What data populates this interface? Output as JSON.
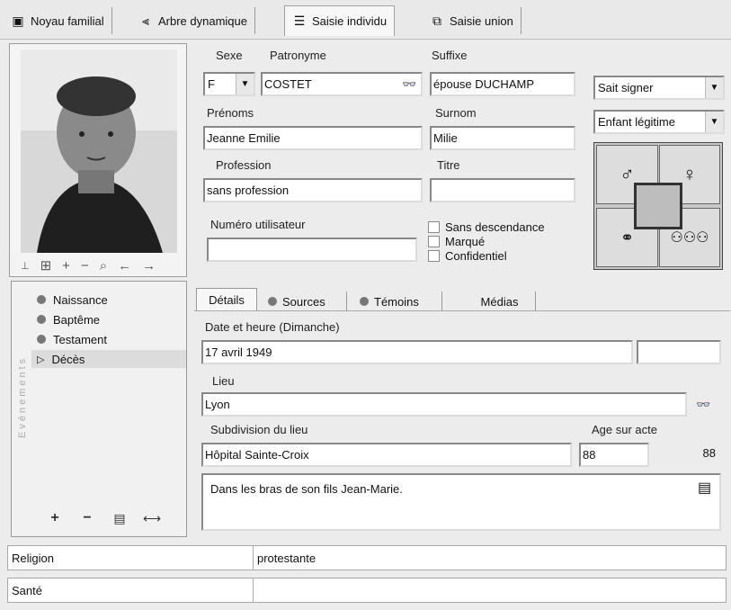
{
  "tabs": [
    {
      "label": "Noyau familial",
      "icon": "square-icon"
    },
    {
      "label": "Arbre dynamique",
      "icon": "tree-icon"
    },
    {
      "label": "Saisie individu",
      "icon": "list-icon"
    },
    {
      "label": "Saisie union",
      "icon": "union-icon"
    }
  ],
  "identity": {
    "sexe_label": "Sexe",
    "sexe_value": "F",
    "patronyme_label": "Patronyme",
    "patronyme_value": "COSTET",
    "suffixe_label": "Suffixe",
    "suffixe_value": "épouse DUCHAMP",
    "prenoms_label": "Prénoms",
    "prenoms_value": "Jeanne Emilie",
    "surnom_label": "Surnom",
    "surnom_value": "Milie",
    "profession_label": "Profession",
    "profession_value": "sans profession",
    "titre_label": "Titre",
    "titre_value": "",
    "numero_label": "Numéro utilisateur",
    "numero_value": "",
    "checks": [
      {
        "label": "Sans descendance",
        "checked": false
      },
      {
        "label": "Marqué",
        "checked": false
      },
      {
        "label": "Confidentiel",
        "checked": false
      }
    ]
  },
  "side": {
    "sait_signer": "Sait signer",
    "filiation": "Enfant légitime"
  },
  "photo_toolbar": {
    "page_icon": "page-icon",
    "grid_icon": "grid-icon",
    "plus": "+",
    "minus": "−",
    "search_icon": "search-icon",
    "left": "←",
    "right": "→"
  },
  "events": {
    "vertical_label": "Evénements",
    "items": [
      {
        "label": "Naissance",
        "type": "dot"
      },
      {
        "label": "Baptême",
        "type": "dot"
      },
      {
        "label": "Testament",
        "type": "dot"
      },
      {
        "label": "Décès",
        "type": "arrow"
      }
    ]
  },
  "details_tabs": [
    {
      "label": "Détails"
    },
    {
      "label": "Sources"
    },
    {
      "label": "Témoins"
    },
    {
      "label": "Médias"
    }
  ],
  "details": {
    "date_label": "Date et heure (Dimanche)",
    "date_value": "17 avril 1949",
    "heure_value": "",
    "lieu_label": "Lieu",
    "lieu_value": "Lyon",
    "subdivision_label": "Subdivision du lieu",
    "subdivision_value": "Hôpital Sainte-Croix",
    "age_label": "Age sur acte",
    "age_value": "88",
    "age_calc": "88",
    "note_value": "Dans les bras de son fils Jean-Marie."
  },
  "bottom_rows": [
    {
      "label": "Religion",
      "value": "protestante"
    },
    {
      "label": "Santé",
      "value": ""
    }
  ]
}
